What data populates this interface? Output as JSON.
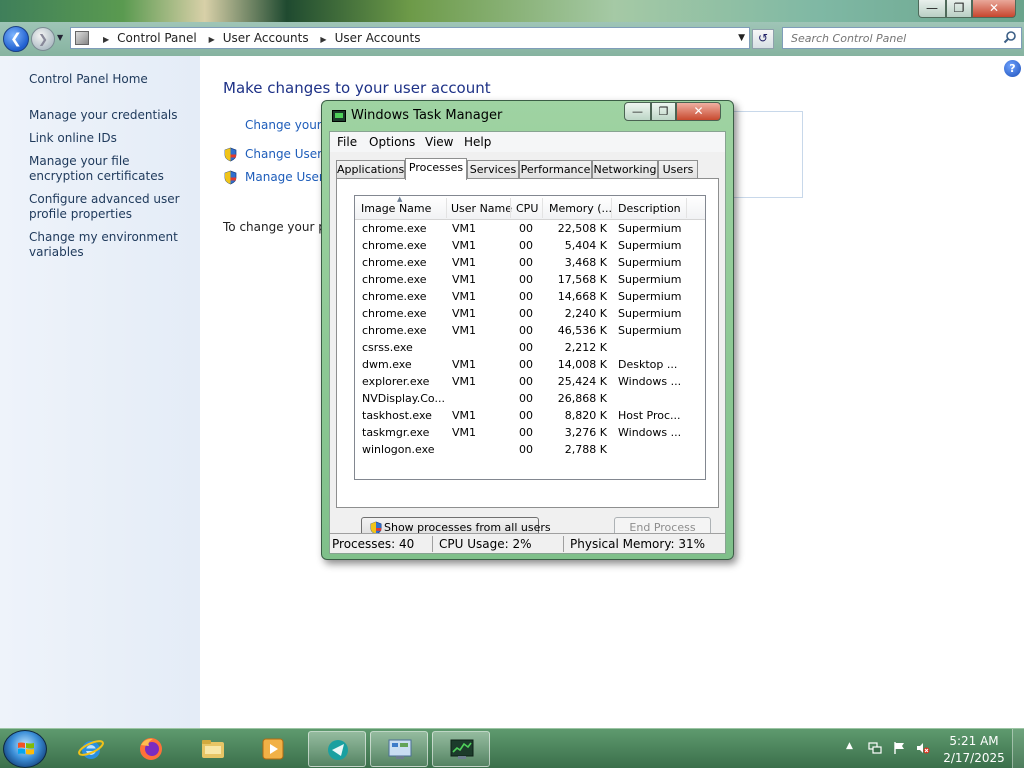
{
  "address": {
    "crumbs": [
      "Control Panel",
      "User Accounts",
      "User Accounts"
    ]
  },
  "search": {
    "placeholder": "Search Control Panel"
  },
  "sidebar": {
    "home": "Control Panel Home",
    "links": [
      "Manage your credentials",
      "Link online IDs",
      "Manage your file encryption certificates",
      "Configure advanced user profile properties",
      "Change my environment variables"
    ]
  },
  "main": {
    "title": "Make changes to your user account",
    "task_change_password": "Change your p",
    "task_change_uac": "Change User A",
    "task_manage_user": "Manage User A",
    "change_text": "To change your pa"
  },
  "task_manager": {
    "title": "Windows Task Manager",
    "menu": [
      "File",
      "Options",
      "View",
      "Help"
    ],
    "tabs": [
      "Applications",
      "Processes",
      "Services",
      "Performance",
      "Networking",
      "Users"
    ],
    "active_tab": "Processes",
    "columns": [
      "Image Name",
      "User Name",
      "CPU",
      "Memory (...",
      "Description"
    ],
    "processes": [
      {
        "name": "chrome.exe",
        "user": "VM1",
        "cpu": "00",
        "mem": "22,508 K",
        "desc": "Supermium"
      },
      {
        "name": "chrome.exe",
        "user": "VM1",
        "cpu": "00",
        "mem": "5,404 K",
        "desc": "Supermium"
      },
      {
        "name": "chrome.exe",
        "user": "VM1",
        "cpu": "00",
        "mem": "3,468 K",
        "desc": "Supermium"
      },
      {
        "name": "chrome.exe",
        "user": "VM1",
        "cpu": "00",
        "mem": "17,568 K",
        "desc": "Supermium"
      },
      {
        "name": "chrome.exe",
        "user": "VM1",
        "cpu": "00",
        "mem": "14,668 K",
        "desc": "Supermium"
      },
      {
        "name": "chrome.exe",
        "user": "VM1",
        "cpu": "00",
        "mem": "2,240 K",
        "desc": "Supermium"
      },
      {
        "name": "chrome.exe",
        "user": "VM1",
        "cpu": "00",
        "mem": "46,536 K",
        "desc": "Supermium"
      },
      {
        "name": "csrss.exe",
        "user": "",
        "cpu": "00",
        "mem": "2,212 K",
        "desc": ""
      },
      {
        "name": "dwm.exe",
        "user": "VM1",
        "cpu": "00",
        "mem": "14,008 K",
        "desc": "Desktop ..."
      },
      {
        "name": "explorer.exe",
        "user": "VM1",
        "cpu": "00",
        "mem": "25,424 K",
        "desc": "Windows ..."
      },
      {
        "name": "NVDisplay.Co...",
        "user": "",
        "cpu": "00",
        "mem": "26,868 K",
        "desc": ""
      },
      {
        "name": "taskhost.exe",
        "user": "VM1",
        "cpu": "00",
        "mem": "8,820 K",
        "desc": "Host Proc..."
      },
      {
        "name": "taskmgr.exe",
        "user": "VM1",
        "cpu": "00",
        "mem": "3,276 K",
        "desc": "Windows ..."
      },
      {
        "name": "winlogon.exe",
        "user": "",
        "cpu": "00",
        "mem": "2,788 K",
        "desc": ""
      }
    ],
    "show_all_label": "Show processes from all users",
    "end_process_label": "End Process",
    "status": {
      "processes": "Processes: 40",
      "cpu": "CPU Usage: 2%",
      "memory": "Physical Memory: 31%"
    }
  },
  "taskbar": {
    "time": "5:21 AM",
    "date": "2/17/2025"
  }
}
